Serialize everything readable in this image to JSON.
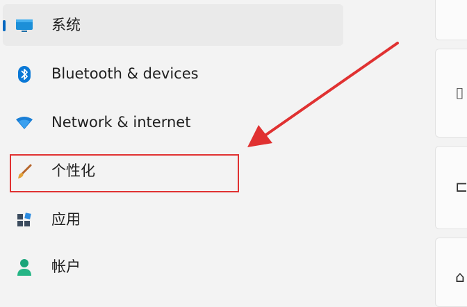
{
  "sidebar": {
    "items": [
      {
        "label": "系统",
        "icon": "monitor-icon",
        "selected": true
      },
      {
        "label": "Bluetooth & devices",
        "icon": "bluetooth-icon"
      },
      {
        "label": "Network & internet",
        "icon": "wifi-icon"
      },
      {
        "label": "个性化",
        "icon": "paintbrush-icon",
        "highlighted": true
      },
      {
        "label": "应用",
        "icon": "apps-icon"
      },
      {
        "label": "帐户",
        "icon": "person-icon"
      }
    ]
  },
  "annotation": {
    "highlight_color": "#e03131",
    "arrow_color": "#e03131"
  },
  "accent_color": "#0067c0"
}
